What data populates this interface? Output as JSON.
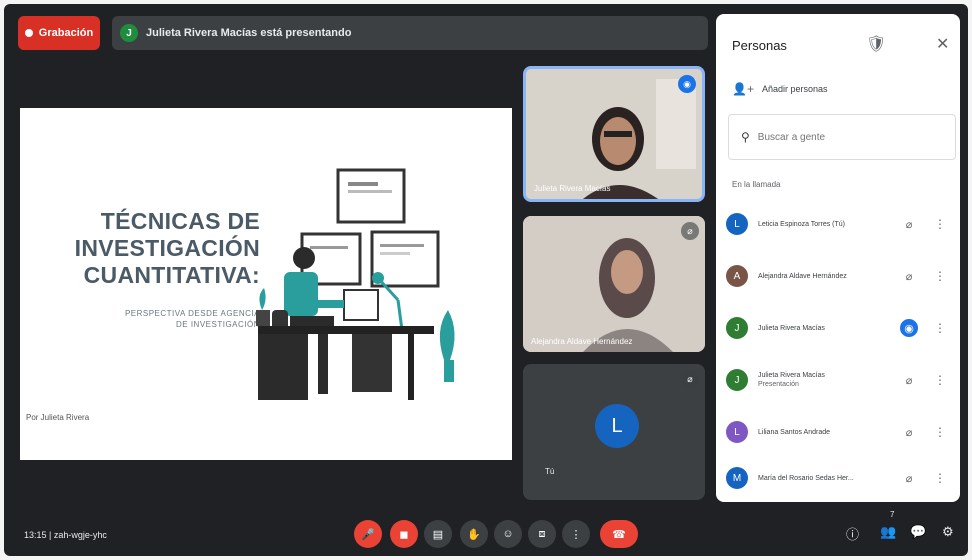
{
  "top_bar": {
    "recording_label": "Grabación",
    "presenter_initial": "J",
    "presenting_text": "Julieta Rivera Macías está presentando"
  },
  "slide": {
    "title_lines": [
      "TÉCNICAS DE",
      "INVESTIGACIÓN",
      "CUANTITATIVA:"
    ],
    "subtitle_lines": [
      "PERSPECTIVA DESDE AGENCIA",
      "DE INVESTIGACIÓN"
    ],
    "author": "Por Julieta Rivera"
  },
  "tiles": [
    {
      "name": "Julieta Rivera Macías",
      "state": "speaking"
    },
    {
      "name": "Alejandra Aldave Hernández",
      "state": "muted"
    },
    {
      "name": "Tú",
      "initial": "L",
      "state": "muted"
    }
  ],
  "people_panel": {
    "title": "Personas",
    "add_people": "Añadir personas",
    "search_placeholder": "Buscar a gente",
    "section": "En la llamada",
    "people": [
      {
        "initial": "L",
        "name": "Leticia Espinoza Torres (Tú)",
        "mic": "off",
        "color": "#1565c0"
      },
      {
        "initial": "A",
        "name": "Alejandra Aldave Hernández",
        "mic": "off",
        "color": "#795548"
      },
      {
        "initial": "J",
        "name": "Julieta Rivera Macías",
        "mic": "speaking",
        "color": "#2e7d32"
      },
      {
        "initial": "J",
        "name": "Julieta Rivera Macías",
        "subline": "Presentación",
        "mic": "off",
        "color": "#2e7d32"
      },
      {
        "initial": "L",
        "name": "Liliana Santos Andrade",
        "mic": "off",
        "color": "#7e57c2"
      },
      {
        "initial": "M",
        "name": "María del Rosario Sedas Her...",
        "mic": "off",
        "color": "#1565c0"
      }
    ]
  },
  "bottom_bar": {
    "time_code": "13:15  |  zah-wgje-yhc",
    "people_count": "7"
  },
  "colors": {
    "accent_red": "#ea4335",
    "accent_blue": "#1a73e8",
    "background": "#202124"
  }
}
